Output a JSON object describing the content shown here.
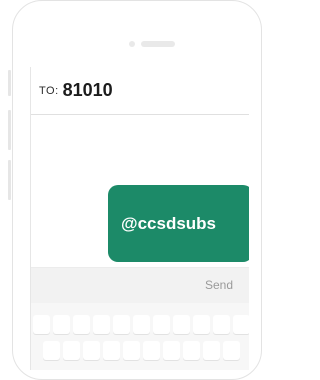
{
  "compose": {
    "to_label": "TO:",
    "to_number": "81010"
  },
  "message": {
    "text": "@ccsdsubs"
  },
  "toolbar": {
    "send_label": "Send"
  },
  "colors": {
    "bubble": "#1c8a68",
    "send_text": "#9a9a9a"
  }
}
